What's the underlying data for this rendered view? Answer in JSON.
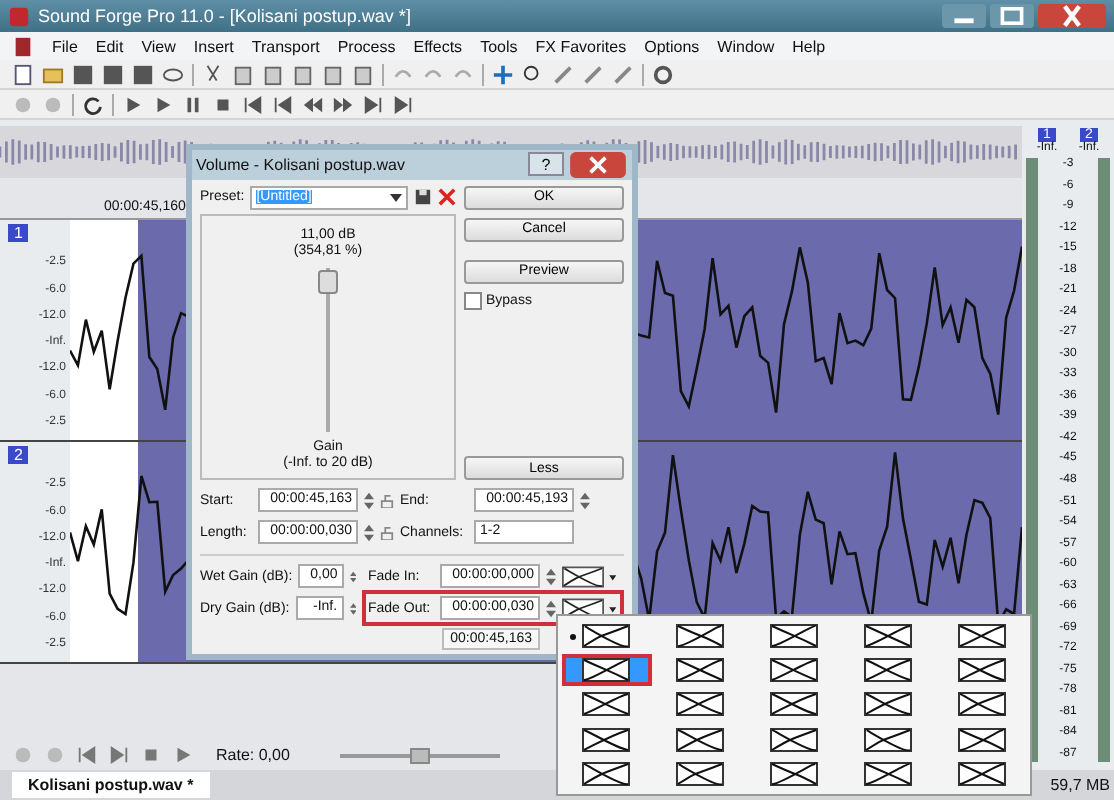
{
  "window": {
    "title": "Sound Forge Pro 11.0 - [Kolisani postup.wav *]"
  },
  "menu": [
    "File",
    "Edit",
    "View",
    "Insert",
    "Transport",
    "Process",
    "Effects",
    "Tools",
    "FX Favorites",
    "Options",
    "Window",
    "Help"
  ],
  "timeline": {
    "position": "00:00:45,160"
  },
  "channels": [
    {
      "number": "1",
      "ticks": [
        "-2.5",
        "-6.0",
        "-12.0",
        "-Inf.",
        "-12.0",
        "-6.0",
        "-2.5"
      ]
    },
    {
      "number": "2",
      "ticks": [
        "-2.5",
        "-6.0",
        "-12.0",
        "-Inf.",
        "-12.0",
        "-6.0",
        "-2.5"
      ]
    }
  ],
  "meter": {
    "channels": [
      "1",
      "2"
    ],
    "readings": [
      "-Inf.",
      "-Inf."
    ],
    "ticks": [
      "-3",
      "-6",
      "-9",
      "-12",
      "-15",
      "-18",
      "-21",
      "-24",
      "-27",
      "-30",
      "-33",
      "-36",
      "-39",
      "-42",
      "-45",
      "-48",
      "-51",
      "-54",
      "-57",
      "-60",
      "-63",
      "-66",
      "-69",
      "-72",
      "-75",
      "-78",
      "-81",
      "-84",
      "-87"
    ]
  },
  "transport": {
    "rate": "Rate: 0,00",
    "level": 0.5
  },
  "document_tab": {
    "label": "Kolisani postup.wav *"
  },
  "status_bar": {
    "memory": "59,7 MB"
  },
  "dialog": {
    "title": "Volume - Kolisani postup.wav",
    "help": "?",
    "preset_label": "Preset:",
    "preset": "[Untitled]",
    "preset_text_selected": true,
    "gain": {
      "value": "11,00 dB",
      "percent": "(354,81 %)",
      "label": "Gain",
      "range": "(-Inf. to 20 dB)",
      "level": 0.92
    },
    "buttons": [
      "OK",
      "Cancel",
      "Preview"
    ],
    "bypass": {
      "label": "Bypass",
      "checked": false
    },
    "less": "Less",
    "start": {
      "label": "Start:",
      "value": "00:00:45,163"
    },
    "end": {
      "label": "End:",
      "value": "00:00:45,193"
    },
    "length": {
      "label": "Length:",
      "value": "00:00:00,030"
    },
    "channels": {
      "label": "Channels:",
      "value": "1-2"
    },
    "wet_gain": {
      "label": "Wet Gain (dB):",
      "value": "0,00"
    },
    "dry_gain": {
      "label": "Dry Gain (dB):",
      "value": "-Inf."
    },
    "fade_in": {
      "label": "Fade In:",
      "value": "00:00:00,000",
      "highlighted": false
    },
    "fade_out": {
      "label": "Fade Out:",
      "value": "00:00:00,030",
      "highlighted": true
    },
    "footer_time": "00:00:45,163"
  },
  "fade_menu": {
    "items": [
      {
        "checked": true,
        "selected": false
      },
      {
        "checked": false,
        "selected": true
      },
      {
        "checked": false,
        "selected": false
      },
      {
        "checked": false,
        "selected": false
      },
      {
        "checked": false,
        "selected": false
      },
      {
        "selected": false
      },
      {
        "selected": false
      },
      {
        "selected": false
      },
      {
        "selected": false
      },
      {
        "selected": false
      },
      {
        "selected": false
      },
      {
        "selected": false
      },
      {
        "selected": false
      },
      {
        "selected": false
      },
      {
        "selected": false
      },
      {
        "selected": false
      },
      {
        "selected": false
      },
      {
        "selected": false
      },
      {
        "selected": false
      },
      {
        "selected": false
      },
      {
        "selected": false
      },
      {
        "selected": false
      },
      {
        "selected": false
      },
      {
        "selected": false
      },
      {
        "selected": false
      }
    ]
  }
}
